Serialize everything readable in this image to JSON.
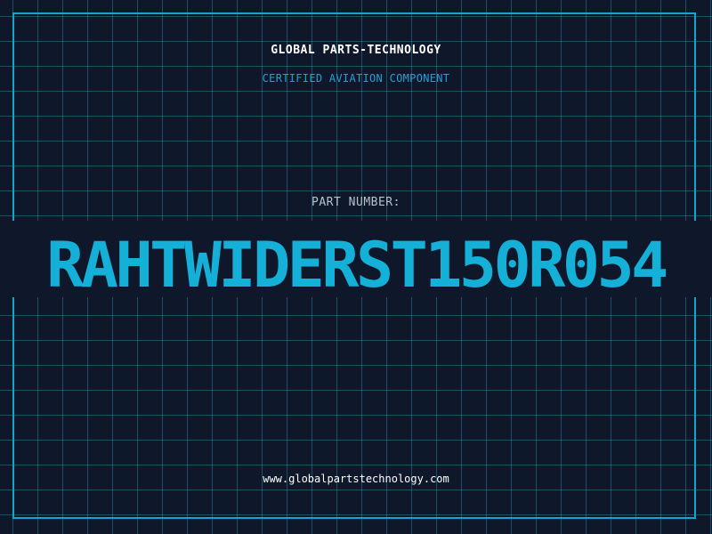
{
  "header": {
    "company_name": "GLOBAL PARTS-TECHNOLOGY",
    "subtitle": "CERTIFIED AVIATION COMPONENT"
  },
  "part": {
    "label": "PART NUMBER:",
    "number": "RAHTWIDERST150R054"
  },
  "footer": {
    "website": "www.globalpartstechnology.com"
  },
  "colors": {
    "background": "#0f172a",
    "grid": "#2e7c96",
    "accent": "#12a6cf",
    "text_primary": "#ffffff",
    "text_muted": "#b8c2cc"
  }
}
